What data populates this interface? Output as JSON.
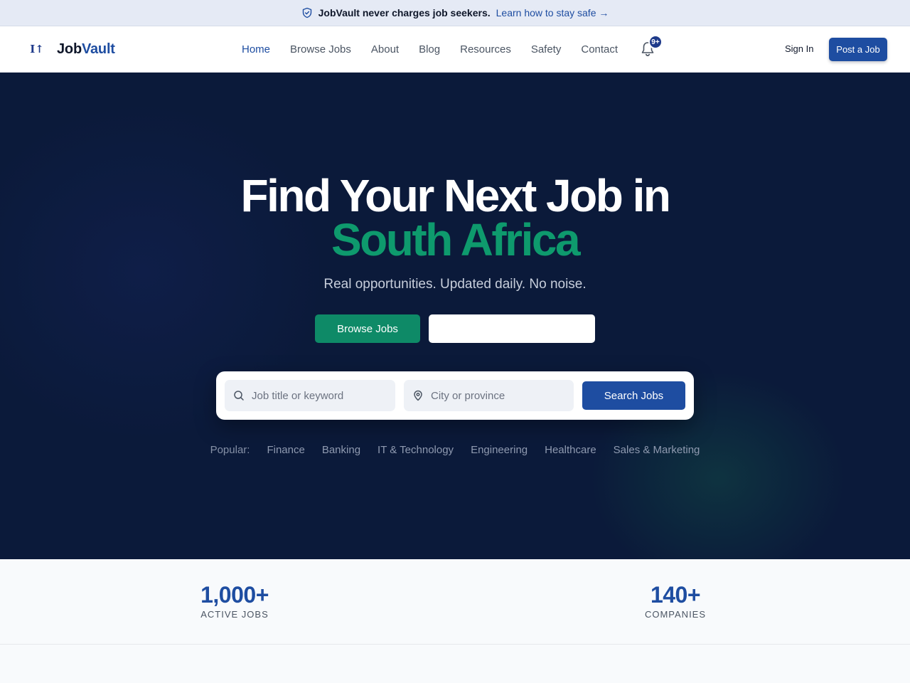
{
  "announcement": {
    "icon": "shield-check-icon",
    "message": "JobVault never charges job seekers.",
    "link": "Learn how to stay safe →"
  },
  "nav": {
    "logo_mark": "Ⅰ↑",
    "brand_first": "Job",
    "brand_second": "Vault",
    "items": [
      {
        "label": "Home",
        "active": true
      },
      {
        "label": "Browse Jobs",
        "active": false
      },
      {
        "label": "About",
        "active": false
      },
      {
        "label": "Blog",
        "active": false
      },
      {
        "label": "Resources",
        "active": false
      },
      {
        "label": "Safety",
        "active": false
      },
      {
        "label": "Contact",
        "active": false
      }
    ],
    "notification_badge": "9+",
    "sign_in": "Sign In",
    "post_job": "Post a Job"
  },
  "hero": {
    "title_line1": "Find Your Next Job in",
    "title_line2": "South Africa",
    "subtitle": "Real opportunities. Updated daily. No noise.",
    "browse_button": "Browse Jobs",
    "search": {
      "keyword_placeholder": "Job title or keyword",
      "location_placeholder": "City or province",
      "button": "Search Jobs"
    },
    "popular_label": "Popular:",
    "popular_tags": [
      "Finance",
      "Banking",
      "IT & Technology",
      "Engineering",
      "Healthcare",
      "Sales & Marketing"
    ]
  },
  "stats": [
    {
      "value": "1,000+",
      "label": "ACTIVE JOBS"
    },
    {
      "value": "140+",
      "label": "COMPANIES"
    }
  ],
  "colors": {
    "brand_blue": "#1e4da1",
    "accent_green": "#0e9a6d",
    "hero_bg": "#0b1a3a"
  }
}
